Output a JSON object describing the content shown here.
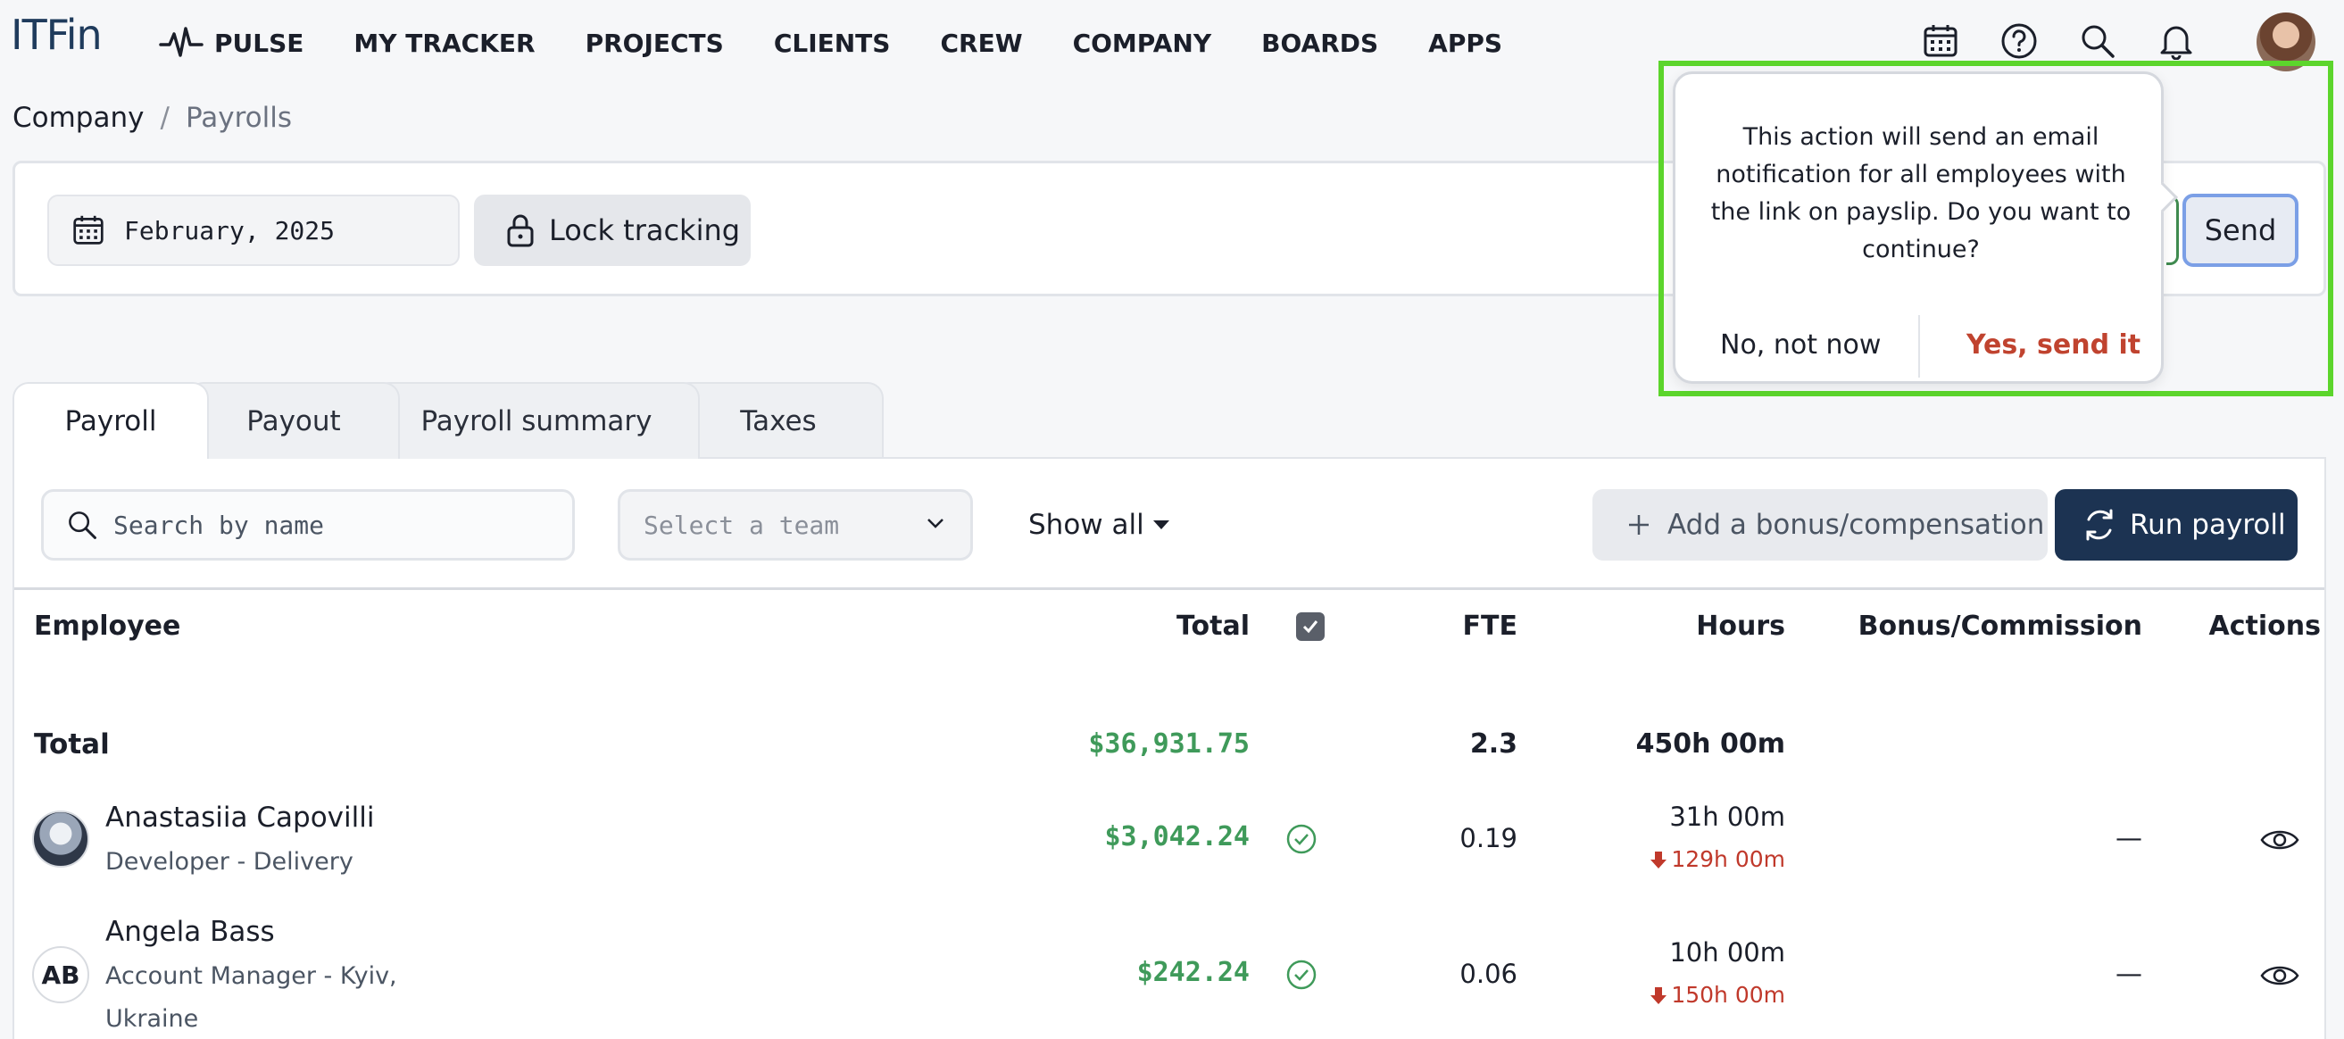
{
  "app": {
    "logo": "ITFin"
  },
  "nav": {
    "items": [
      {
        "label": "PULSE",
        "icon": "pulse-icon"
      },
      {
        "label": "MY TRACKER"
      },
      {
        "label": "PROJECTS"
      },
      {
        "label": "CLIENTS"
      },
      {
        "label": "CREW"
      },
      {
        "label": "COMPANY"
      },
      {
        "label": "BOARDS"
      },
      {
        "label": "APPS"
      }
    ],
    "icons": [
      "calendar-icon",
      "help-icon",
      "search-icon",
      "bell-icon"
    ]
  },
  "breadcrumb": {
    "parent": "Company",
    "separator": "/",
    "current": "Payrolls"
  },
  "filter": {
    "date": "February, 2025",
    "lock_label": "Lock tracking",
    "send_label": "Send"
  },
  "popover": {
    "message": "This action will send an email\nnotification for all employees with\nthe link on payslip. Do you want to\ncontinue?",
    "cancel_label": "No, not now",
    "confirm_label": "Yes, send it",
    "confirm_color": "#c0432f"
  },
  "tabs": [
    {
      "label": "Payroll",
      "active": true
    },
    {
      "label": "Payout",
      "active": false
    },
    {
      "label": "Payroll summary",
      "active": false
    },
    {
      "label": "Taxes",
      "active": false
    }
  ],
  "toolbar": {
    "search_placeholder": "Search by name",
    "team_placeholder": "Select a team",
    "show_all_label": "Show all",
    "bonus_label": "Add a bonus/compensation",
    "run_label": "Run payroll"
  },
  "table": {
    "columns": {
      "employee": "Employee",
      "total": "Total",
      "fte": "FTE",
      "hours": "Hours",
      "bonus": "Bonus/Commission",
      "actions": "Actions"
    },
    "summary": {
      "label": "Total",
      "total": "$36,931.75",
      "fte": "2.3",
      "hours": "450h 00m"
    },
    "rows": [
      {
        "name": "Anastasiia Capovilli",
        "role": "Developer - Delivery",
        "total": "$3,042.24",
        "fte": "0.19",
        "hours": "31h 00m",
        "deficit": "129h 00m",
        "bonus": "—",
        "avatar": "photo"
      },
      {
        "name": "Angela Bass",
        "role_line1": "Account Manager - Kyiv,",
        "role_line2": "Ukraine",
        "initials": "AB",
        "total": "$242.24",
        "fte": "0.06",
        "hours": "10h 00m",
        "deficit": "150h 00m",
        "bonus": "—"
      }
    ]
  },
  "colors": {
    "primary": "#1c3352",
    "money_green": "#3f9a5a",
    "deficit_red": "#c0392b",
    "highlight": "#5cd52c"
  }
}
